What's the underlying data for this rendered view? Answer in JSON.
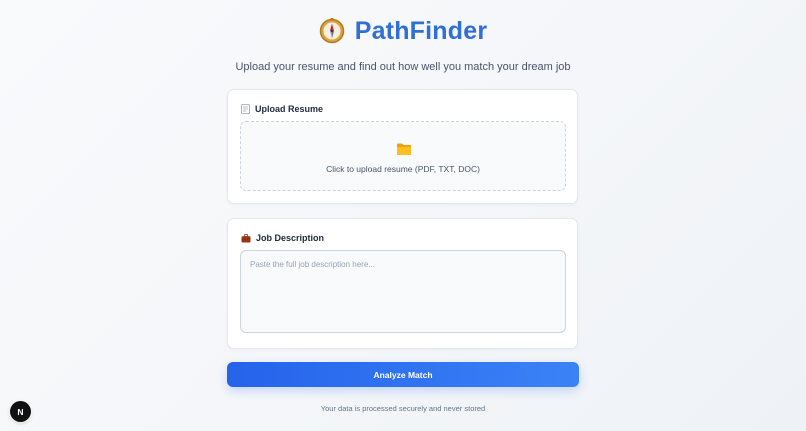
{
  "header": {
    "logo_icon": "compass-icon",
    "title": "PathFinder",
    "subtitle": "Upload your resume and find out how well you match your dream job"
  },
  "upload_card": {
    "icon": "document-icon",
    "label": "Upload Resume",
    "dropzone_icon": "folder-icon",
    "dropzone_text": "Click to upload resume (PDF, TXT, DOC)"
  },
  "job_card": {
    "icon": "briefcase-icon",
    "label": "Job Description",
    "value": "",
    "placeholder": "Paste the full job description here..."
  },
  "analyze_button": {
    "label": "Analyze Match"
  },
  "footer": {
    "note": "Your data is processed securely and never stored"
  },
  "dev_badge": {
    "label": "N"
  },
  "colors": {
    "brand": "#2f6fd6",
    "button_start": "#2563eb",
    "button_end": "#3b82f6",
    "folder": "#fbbf24"
  }
}
